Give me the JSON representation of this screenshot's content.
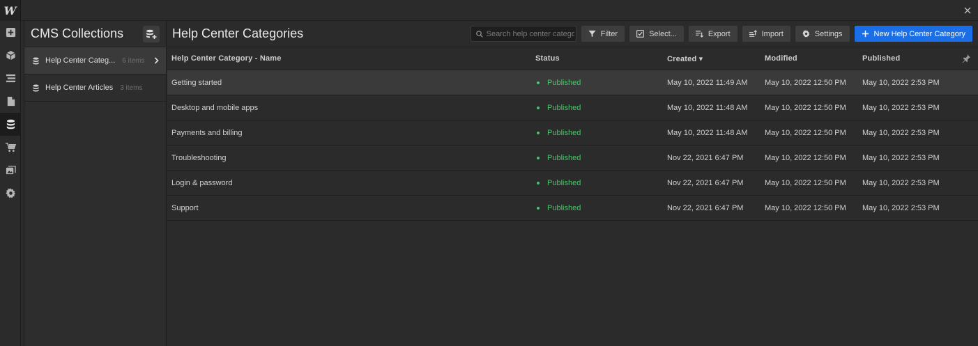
{
  "app": {
    "logo_letter": "W"
  },
  "colors": {
    "accent": "#1a6fe8",
    "published": "#4cc36b"
  },
  "rail": [
    {
      "icon": "add-panel-icon"
    },
    {
      "icon": "cube-icon"
    },
    {
      "icon": "navigator-icon"
    },
    {
      "icon": "pages-icon"
    },
    {
      "icon": "database-icon",
      "active": true
    },
    {
      "icon": "cart-icon"
    },
    {
      "icon": "assets-icon"
    },
    {
      "icon": "gear-icon"
    }
  ],
  "collections": {
    "title": "CMS Collections",
    "items": [
      {
        "name": "Help Center Categ...",
        "count": "6 items"
      },
      {
        "name": "Help Center Articles",
        "count": "3 items"
      }
    ]
  },
  "main": {
    "title": "Help Center Categories",
    "search_placeholder": "Search help center categories",
    "buttons": {
      "filter": "Filter",
      "select": "Select...",
      "export": "Export",
      "import": "Import",
      "settings": "Settings",
      "new": "New Help Center Category"
    }
  },
  "table": {
    "headers": {
      "name": "Help Center Category - Name",
      "status": "Status",
      "created": "Created ▾",
      "modified": "Modified",
      "published": "Published"
    },
    "rows": [
      {
        "name": "Getting started",
        "status": "Published",
        "created": "May 10, 2022 11:49 AM",
        "modified": "May 10, 2022 12:50 PM",
        "published": "May 10, 2022 2:53 PM"
      },
      {
        "name": "Desktop and mobile apps",
        "status": "Published",
        "created": "May 10, 2022 11:48 AM",
        "modified": "May 10, 2022 12:50 PM",
        "published": "May 10, 2022 2:53 PM"
      },
      {
        "name": "Payments and billing",
        "status": "Published",
        "created": "May 10, 2022 11:48 AM",
        "modified": "May 10, 2022 12:50 PM",
        "published": "May 10, 2022 2:53 PM"
      },
      {
        "name": "Troubleshooting",
        "status": "Published",
        "created": "Nov 22, 2021 6:47 PM",
        "modified": "May 10, 2022 12:50 PM",
        "published": "May 10, 2022 2:53 PM"
      },
      {
        "name": "Login & password",
        "status": "Published",
        "created": "Nov 22, 2021 6:47 PM",
        "modified": "May 10, 2022 12:50 PM",
        "published": "May 10, 2022 2:53 PM"
      },
      {
        "name": "Support",
        "status": "Published",
        "created": "Nov 22, 2021 6:47 PM",
        "modified": "May 10, 2022 12:50 PM",
        "published": "May 10, 2022 2:53 PM"
      }
    ]
  }
}
